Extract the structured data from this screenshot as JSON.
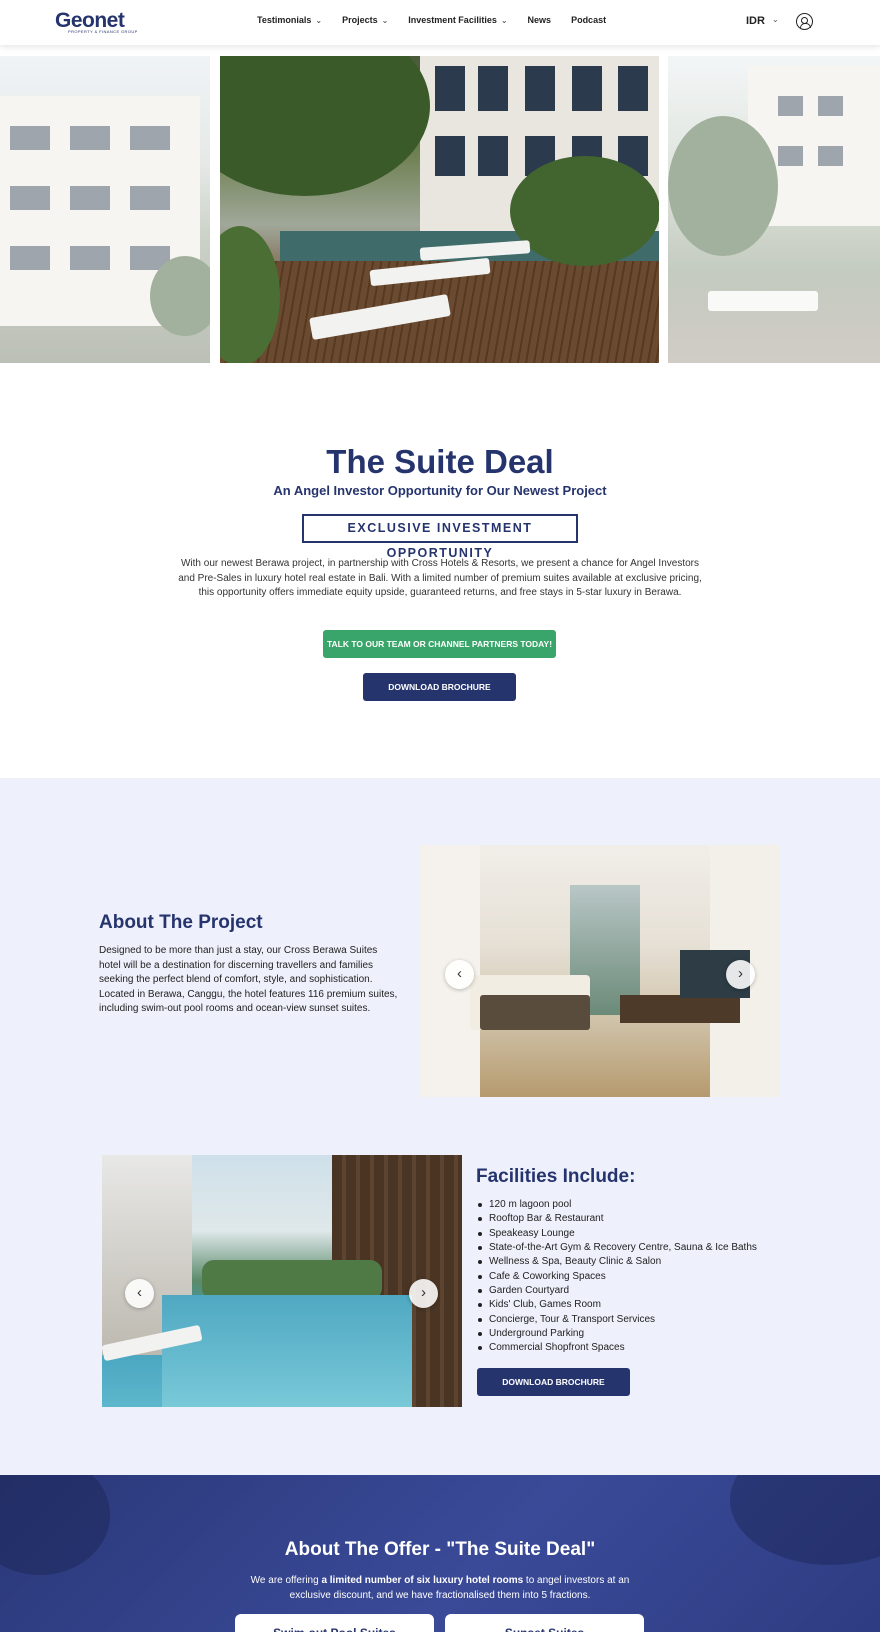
{
  "nav": {
    "logo_text": "Geonet",
    "logo_sub": "PROPERTY & FINANCE GROUP",
    "links": [
      {
        "label": "Testimonials",
        "dropdown": true
      },
      {
        "label": "Projects",
        "dropdown": true
      },
      {
        "label": "Investment Facilities",
        "dropdown": true
      },
      {
        "label": "News",
        "dropdown": false
      },
      {
        "label": "Podcast",
        "dropdown": false
      }
    ],
    "currency": "IDR",
    "icons": {
      "dropdown": "chevron-down-icon",
      "account": "user-circle-icon"
    }
  },
  "suite": {
    "title": "The Suite Deal",
    "subtitle": "An Angel Investor Opportunity for Our Newest Project",
    "badge": "EXCLUSIVE INVESTMENT OPPORTUNITY",
    "description": "With our newest Berawa project, in partnership with Cross Hotels & Resorts, we present a chance for Angel Investors and Pre-Sales in luxury hotel real estate in Bali. With a limited number of premium suites available at exclusive pricing, this opportunity offers immediate equity upside, guaranteed returns, and free stays in 5-star luxury in Berawa.",
    "cta_talk": "TALK TO OUR TEAM OR CHANNEL PARTNERS TODAY!",
    "cta_brochure": "DOWNLOAD BROCHURE"
  },
  "about": {
    "title": "About The Project",
    "text": "Designed to be more than just a stay, our Cross Berawa Suites hotel will be a destination for discerning travellers and families seeking the perfect blend of comfort, style, and sophistication. Located in Berawa, Canggu, the hotel features 116 premium suites, including swim-out pool rooms and ocean-view sunset suites."
  },
  "facilities": {
    "title": "Facilities Include:",
    "items": [
      "120 m lagoon pool",
      "Rooftop Bar & Restaurant",
      "Speakeasy Lounge",
      "State-of-the-Art Gym & Recovery Centre, Sauna & Ice Baths",
      "Wellness & Spa, Beauty Clinic & Salon",
      "Cafe & Coworking Spaces",
      "Garden Courtyard",
      "Kids' Club, Games Room",
      "Concierge, Tour & Transport Services",
      "Underground Parking",
      "Commercial Shopfront Spaces"
    ],
    "cta_brochure": "DOWNLOAD BROCHURE"
  },
  "offer": {
    "title": "About The Offer - \"The Suite Deal\"",
    "text_pre": "We are offering ",
    "text_bold": "a limited number of six luxury hotel rooms",
    "text_post": " to angel investors at an exclusive discount, and we have fractionalised them into 5 fractions.",
    "cards": [
      "Swim-out Pool Suites",
      "Sunset Suites"
    ]
  },
  "colors": {
    "navy": "#26346e",
    "green": "#3aa56a",
    "light_bg": "#eef1fb"
  }
}
